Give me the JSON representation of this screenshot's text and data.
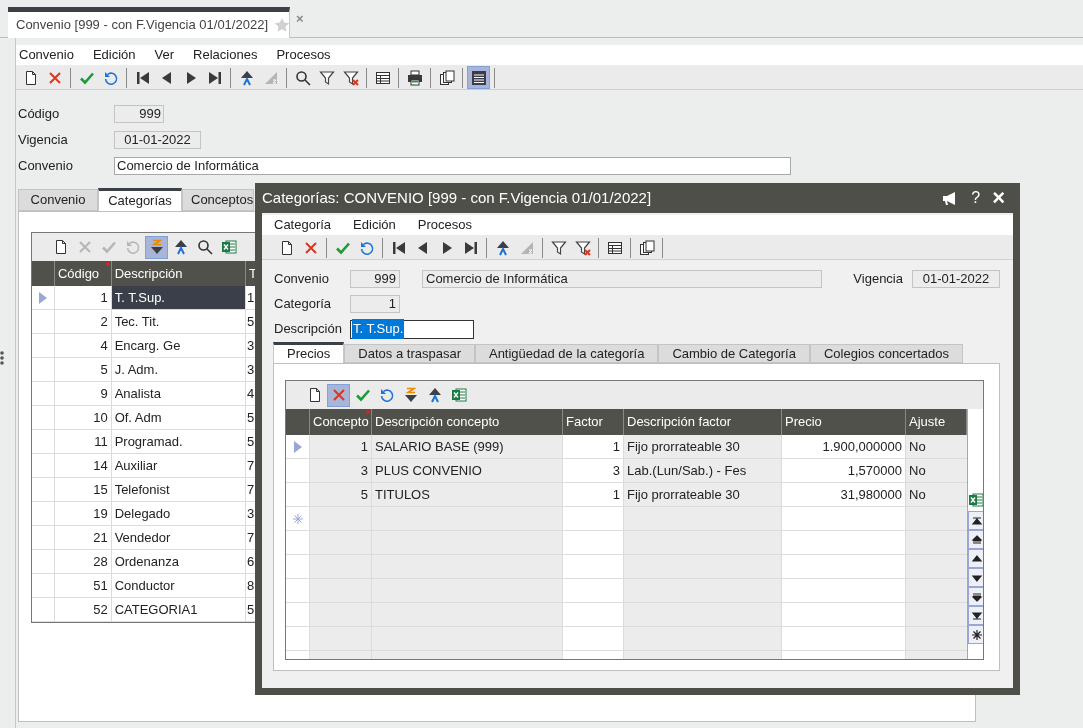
{
  "document_tab": {
    "title": "Convenio [999 - con F.Vigencia 01/01/2022]",
    "favorite": false,
    "close": "×"
  },
  "menu": [
    "Convenio",
    "Edición",
    "Ver",
    "Relaciones",
    "Procesos"
  ],
  "toolbar": [
    {
      "kind": "new",
      "pressed": false
    },
    {
      "kind": "delete",
      "pressed": false
    },
    {
      "kind": "separator"
    },
    {
      "kind": "save",
      "pressed": false
    },
    {
      "kind": "undo",
      "pressed": false
    },
    {
      "kind": "separator"
    },
    {
      "kind": "first",
      "pressed": false
    },
    {
      "kind": "prev",
      "pressed": false
    },
    {
      "kind": "next",
      "pressed": false
    },
    {
      "kind": "last",
      "pressed": false
    },
    {
      "kind": "separator"
    },
    {
      "kind": "sort-asc",
      "pressed": false
    },
    {
      "kind": "sort-off",
      "pressed": false
    },
    {
      "kind": "separator"
    },
    {
      "kind": "search",
      "pressed": false
    },
    {
      "kind": "filter",
      "pressed": false
    },
    {
      "kind": "filter-clear",
      "pressed": false
    },
    {
      "kind": "separator"
    },
    {
      "kind": "table",
      "pressed": false
    },
    {
      "kind": "separator"
    },
    {
      "kind": "print",
      "pressed": false
    },
    {
      "kind": "separator"
    },
    {
      "kind": "copy",
      "pressed": false
    },
    {
      "kind": "separator"
    },
    {
      "kind": "form",
      "pressed": true
    },
    {
      "kind": "separator"
    }
  ],
  "fields": [
    {
      "label": "Código",
      "value": "999",
      "kind": "number",
      "readonly": true
    },
    {
      "label": "Vigencia",
      "value": "01-01-2022",
      "kind": "date",
      "readonly": true
    },
    {
      "label": "Convenio",
      "value": "Comercio de Informática",
      "kind": "text",
      "readonly": false
    }
  ],
  "tabs": [
    {
      "label": "Convenio",
      "selected": false
    },
    {
      "label": "Categorías",
      "selected": true
    },
    {
      "label": "Conceptos",
      "selected": false
    }
  ],
  "grid": {
    "toolbar": [
      {
        "kind": "new",
        "disabled": false,
        "pressed": false
      },
      {
        "kind": "delete",
        "disabled": true,
        "pressed": false
      },
      {
        "kind": "save",
        "disabled": true,
        "pressed": false
      },
      {
        "kind": "undo",
        "disabled": true,
        "pressed": false
      },
      {
        "kind": "sort-desc",
        "disabled": false,
        "pressed": true
      },
      {
        "kind": "sort-asc",
        "disabled": false,
        "pressed": false
      },
      {
        "kind": "search",
        "disabled": false,
        "pressed": false
      },
      {
        "kind": "excel",
        "disabled": false,
        "pressed": false
      }
    ],
    "columns": [
      {
        "label": "Código",
        "required": true
      },
      {
        "label": "Descripción",
        "required": false
      },
      {
        "label": "T",
        "required": false
      }
    ],
    "rows": [
      {
        "codigo": "1",
        "descripcion": "T. T.Sup.",
        "column_3": "1",
        "current": true
      },
      {
        "codigo": "2",
        "descripcion": "Tec. Tit.",
        "column_3": "5",
        "current": false
      },
      {
        "codigo": "4",
        "descripcion": "Encarg. Ge",
        "column_3": "3",
        "current": false
      },
      {
        "codigo": "5",
        "descripcion": "J. Adm.",
        "column_3": "3",
        "current": false
      },
      {
        "codigo": "9",
        "descripcion": "Analista",
        "column_3": "4",
        "current": false
      },
      {
        "codigo": "10",
        "descripcion": "Of. Adm",
        "column_3": "5",
        "current": false
      },
      {
        "codigo": "11",
        "descripcion": "Programad.",
        "column_3": "5",
        "current": false
      },
      {
        "codigo": "14",
        "descripcion": "Auxiliar",
        "column_3": "7",
        "current": false
      },
      {
        "codigo": "15",
        "descripcion": "Telefonist",
        "column_3": "7",
        "current": false
      },
      {
        "codigo": "19",
        "descripcion": "Delegado",
        "column_3": "3",
        "current": false
      },
      {
        "codigo": "21",
        "descripcion": "Vendedor",
        "column_3": "7",
        "current": false
      },
      {
        "codigo": "28",
        "descripcion": "Ordenanza",
        "column_3": "6",
        "current": false
      },
      {
        "codigo": "51",
        "descripcion": "Conductor",
        "column_3": "8",
        "current": false
      },
      {
        "codigo": "52",
        "descripcion": "CATEGORIA1",
        "column_3": "5",
        "current": false
      }
    ]
  },
  "dialog": {
    "title": "Categorías: CONVENIO [999 - con F.Vigencia 01/01/2022]",
    "help": "?",
    "close": "×",
    "menu": [
      "Categoría",
      "Edición",
      "Procesos"
    ],
    "toolbar": [
      {
        "kind": "new",
        "pressed": false
      },
      {
        "kind": "delete",
        "pressed": false
      },
      {
        "kind": "separator"
      },
      {
        "kind": "save",
        "pressed": false
      },
      {
        "kind": "undo",
        "pressed": false
      },
      {
        "kind": "separator"
      },
      {
        "kind": "first",
        "pressed": false
      },
      {
        "kind": "prev",
        "pressed": false
      },
      {
        "kind": "next",
        "pressed": false
      },
      {
        "kind": "last",
        "pressed": false
      },
      {
        "kind": "separator"
      },
      {
        "kind": "sort-asc",
        "pressed": false
      },
      {
        "kind": "sort-off",
        "pressed": false
      },
      {
        "kind": "separator"
      },
      {
        "kind": "filter",
        "pressed": false
      },
      {
        "kind": "filter-clear",
        "pressed": false
      },
      {
        "kind": "separator"
      },
      {
        "kind": "table",
        "pressed": false
      },
      {
        "kind": "separator"
      },
      {
        "kind": "copy",
        "pressed": false
      },
      {
        "kind": "separator"
      }
    ],
    "convenio": {
      "label": "Convenio",
      "code": "999",
      "name": "Comercio de Informática"
    },
    "vigencia": {
      "label": "Vigencia",
      "value": "01-01-2022"
    },
    "categoria": {
      "label": "Categoría",
      "value": "1"
    },
    "descripcion": {
      "label": "Descripción",
      "value": "T. T.Sup.",
      "selected": true
    },
    "tabs": [
      {
        "label": "Precios",
        "selected": true
      },
      {
        "label": "Datos a traspasar",
        "selected": false
      },
      {
        "label": "Antigüedad de la categoría",
        "selected": false
      },
      {
        "label": "Cambio de Categoría",
        "selected": false
      },
      {
        "label": "Colegios concertados",
        "selected": false
      }
    ],
    "grid": {
      "toolbar": [
        {
          "kind": "new",
          "disabled": false,
          "pressed": false
        },
        {
          "kind": "delete",
          "disabled": false,
          "pressed": true
        },
        {
          "kind": "save",
          "disabled": false,
          "pressed": false
        },
        {
          "kind": "undo",
          "disabled": false,
          "pressed": false
        },
        {
          "kind": "sort-desc",
          "disabled": false,
          "pressed": false
        },
        {
          "kind": "sort-asc",
          "disabled": false,
          "pressed": false
        },
        {
          "kind": "excel",
          "disabled": false,
          "pressed": false
        }
      ],
      "columns": [
        {
          "label": "Concepto",
          "required": true
        },
        {
          "label": "Descripción concepto",
          "required": false
        },
        {
          "label": "Factor",
          "required": false
        },
        {
          "label": "Descripción factor",
          "required": false
        },
        {
          "label": "Precio",
          "required": false
        },
        {
          "label": "Ajuste",
          "required": false
        }
      ],
      "rows": [
        {
          "concepto": "1",
          "descripcion": "SALARIO BASE (999)",
          "factor": "1",
          "descripcion_factor": "Fijo prorrateable 30",
          "precio": "1.900,000000",
          "ajuste": "No",
          "current": true
        },
        {
          "concepto": "3",
          "descripcion": "PLUS CONVENIO",
          "factor": "3",
          "descripcion_factor": "Lab.(Lun/Sab.) - Fes",
          "precio": "1,570000",
          "ajuste": "No",
          "current": false
        },
        {
          "concepto": "5",
          "descripcion": "TITULOS",
          "factor": "1",
          "descripcion_factor": "Fijo prorrateable 30",
          "precio": "31,980000",
          "ajuste": "No",
          "current": false
        }
      ]
    }
  }
}
